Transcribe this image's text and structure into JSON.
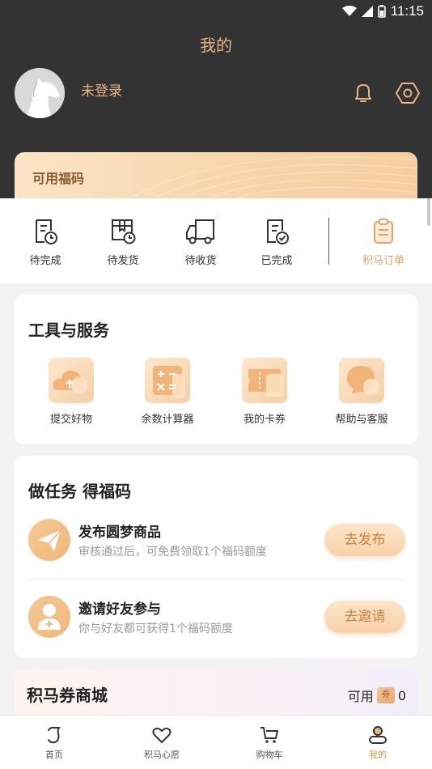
{
  "status_bar": {
    "time": "11:15"
  },
  "header": {
    "title": "我的"
  },
  "profile": {
    "login_status": "未登录"
  },
  "fuma_card": {
    "title": "可用福码"
  },
  "orders": {
    "items": [
      {
        "label": "待完成",
        "icon": "pending-doc-icon"
      },
      {
        "label": "待发货",
        "icon": "box-clock-icon"
      },
      {
        "label": "待收货",
        "icon": "truck-icon"
      },
      {
        "label": "已完成",
        "icon": "doc-check-icon"
      }
    ],
    "jima_order": {
      "label": "积马订单",
      "icon": "clipboard-icon"
    }
  },
  "tools": {
    "title": "工具与服务",
    "items": [
      {
        "label": "提交好物",
        "icon": "cloud-upload-icon"
      },
      {
        "label": "余数计算器",
        "icon": "calculator-icon"
      },
      {
        "label": "我的卡券",
        "icon": "ticket-icon"
      },
      {
        "label": "帮助与客服",
        "icon": "chat-bubble-icon"
      }
    ]
  },
  "tasks": {
    "title": "做任务 得福码",
    "items": [
      {
        "title": "发布圆梦商品",
        "desc": "审核通过后，可免费领取1个福码额度",
        "button": "去发布",
        "icon": "paper-plane-icon"
      },
      {
        "title": "邀请好友参与",
        "desc": "你与好友都可获得1个福码额度",
        "button": "去邀请",
        "icon": "add-friend-icon"
      }
    ]
  },
  "mall": {
    "title": "积马券商城",
    "available_label": "可用",
    "available_count": "0",
    "coupon_glyph": "券"
  },
  "tabbar": {
    "items": [
      {
        "label": "首页",
        "icon": "home-icon",
        "active": false
      },
      {
        "label": "积马心愿",
        "icon": "heart-icon",
        "active": false
      },
      {
        "label": "购物车",
        "icon": "cart-icon",
        "active": false
      },
      {
        "label": "我的",
        "icon": "user-icon",
        "active": true
      }
    ]
  },
  "colors": {
    "gold": "#e9b47f",
    "dark_header": "#333333",
    "accent": "#d8944d"
  }
}
